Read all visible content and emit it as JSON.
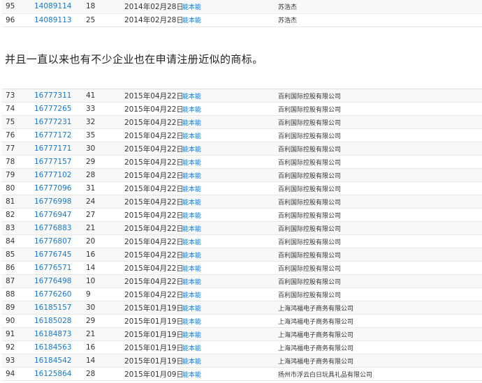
{
  "link_label": "能本能",
  "table_top": {
    "rows": [
      {
        "idx": "95",
        "reg": "14089114",
        "cls": "18",
        "date": "2014年02月28日",
        "link": "能本能",
        "applicant": "苏浩杰"
      },
      {
        "idx": "96",
        "reg": "14089113",
        "cls": "25",
        "date": "2014年02月28日",
        "link": "能本能",
        "applicant": "苏浩杰"
      }
    ]
  },
  "sentence": "并且一直以来也有不少企业也在申请注册近似的商标。",
  "table_main": {
    "rows": [
      {
        "idx": "73",
        "reg": "16777311",
        "cls": "41",
        "date": "2015年04月22日",
        "link": "能本能",
        "applicant": "百利国际控股有限公司"
      },
      {
        "idx": "74",
        "reg": "16777265",
        "cls": "33",
        "date": "2015年04月22日",
        "link": "能本能",
        "applicant": "百利国际控股有限公司"
      },
      {
        "idx": "75",
        "reg": "16777231",
        "cls": "32",
        "date": "2015年04月22日",
        "link": "能本能",
        "applicant": "百利国际控股有限公司"
      },
      {
        "idx": "76",
        "reg": "16777172",
        "cls": "35",
        "date": "2015年04月22日",
        "link": "能本能",
        "applicant": "百利国际控股有限公司"
      },
      {
        "idx": "77",
        "reg": "16777171",
        "cls": "30",
        "date": "2015年04月22日",
        "link": "能本能",
        "applicant": "百利国际控股有限公司"
      },
      {
        "idx": "78",
        "reg": "16777157",
        "cls": "29",
        "date": "2015年04月22日",
        "link": "能本能",
        "applicant": "百利国际控股有限公司"
      },
      {
        "idx": "79",
        "reg": "16777102",
        "cls": "28",
        "date": "2015年04月22日",
        "link": "能本能",
        "applicant": "百利国际控股有限公司"
      },
      {
        "idx": "80",
        "reg": "16777096",
        "cls": "31",
        "date": "2015年04月22日",
        "link": "能本能",
        "applicant": "百利国际控股有限公司"
      },
      {
        "idx": "81",
        "reg": "16776998",
        "cls": "24",
        "date": "2015年04月22日",
        "link": "能本能",
        "applicant": "百利国际控股有限公司"
      },
      {
        "idx": "82",
        "reg": "16776947",
        "cls": "27",
        "date": "2015年04月22日",
        "link": "能本能",
        "applicant": "百利国际控股有限公司"
      },
      {
        "idx": "83",
        "reg": "16776883",
        "cls": "21",
        "date": "2015年04月22日",
        "link": "能本能",
        "applicant": "百利国际控股有限公司"
      },
      {
        "idx": "84",
        "reg": "16776807",
        "cls": "20",
        "date": "2015年04月22日",
        "link": "能本能",
        "applicant": "百利国际控股有限公司"
      },
      {
        "idx": "85",
        "reg": "16776745",
        "cls": "16",
        "date": "2015年04月22日",
        "link": "能本能",
        "applicant": "百利国际控股有限公司"
      },
      {
        "idx": "86",
        "reg": "16776571",
        "cls": "14",
        "date": "2015年04月22日",
        "link": "能本能",
        "applicant": "百利国际控股有限公司"
      },
      {
        "idx": "87",
        "reg": "16776498",
        "cls": "10",
        "date": "2015年04月22日",
        "link": "能本能",
        "applicant": "百利国际控股有限公司"
      },
      {
        "idx": "88",
        "reg": "16776260",
        "cls": "9",
        "date": "2015年04月22日",
        "link": "能本能",
        "applicant": "百利国际控股有限公司"
      },
      {
        "idx": "89",
        "reg": "16185157",
        "cls": "30",
        "date": "2015年01月19日",
        "link": "能本能",
        "applicant": "上海鸿福电子商务有限公司"
      },
      {
        "idx": "90",
        "reg": "16185028",
        "cls": "29",
        "date": "2015年01月19日",
        "link": "能本能",
        "applicant": "上海鸿福电子商务有限公司"
      },
      {
        "idx": "91",
        "reg": "16184873",
        "cls": "21",
        "date": "2015年01月19日",
        "link": "能本能",
        "applicant": "上海鸿福电子商务有限公司"
      },
      {
        "idx": "92",
        "reg": "16184563",
        "cls": "16",
        "date": "2015年01月19日",
        "link": "能本能",
        "applicant": "上海鸿福电子商务有限公司"
      },
      {
        "idx": "93",
        "reg": "16184542",
        "cls": "14",
        "date": "2015年01月19日",
        "link": "能本能",
        "applicant": "上海鸿福电子商务有限公司"
      },
      {
        "idx": "94",
        "reg": "16125864",
        "cls": "28",
        "date": "2015年01月09日",
        "link": "能本能",
        "applicant": "扬州市浮云白日玩具礼品有限公司"
      }
    ]
  },
  "colors": {
    "link": "#1a79c6",
    "text": "#333333",
    "row_alt": "#f8f8f8",
    "border": "#e7e7e7"
  }
}
